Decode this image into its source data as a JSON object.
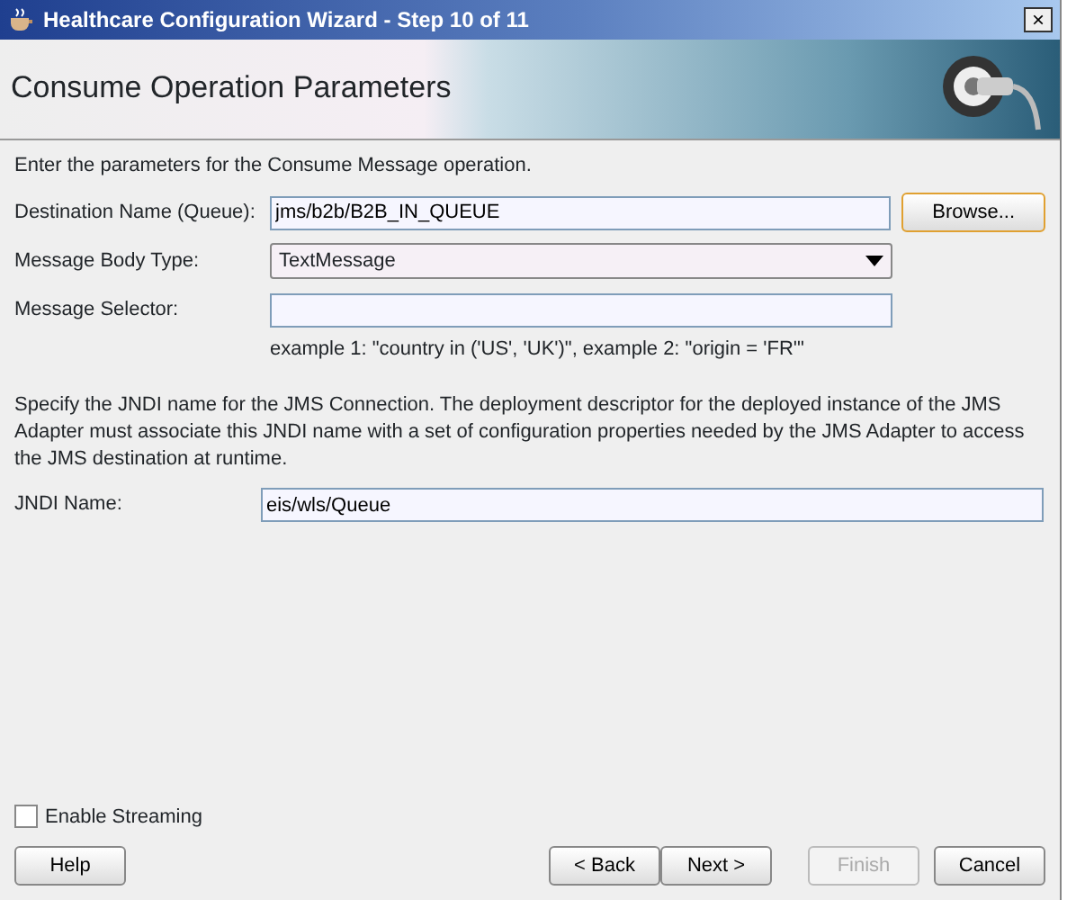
{
  "window": {
    "title": "Healthcare Configuration Wizard - Step 10 of 11",
    "close": "×"
  },
  "header": {
    "title": "Consume Operation Parameters"
  },
  "intro": "Enter the parameters for the Consume Message operation.",
  "fields": [
    {
      "kind": "text",
      "label": "Destination Name (Queue):",
      "value": "jms/b2b/B2B_IN_QUEUE",
      "button": {
        "label": "Browse...",
        "focused": true
      }
    },
    {
      "kind": "select",
      "label": "Message Body Type:",
      "value": "TextMessage"
    },
    {
      "kind": "text",
      "label": "Message Selector:"
    }
  ],
  "example": "example 1: \"country in ('US', 'UK')\", example 2: \"origin = 'FR'\"",
  "jndi_help": "Specify the JNDI name for the JMS Connection.  The deployment descriptor for the deployed instance of the JMS Adapter must associate this JNDI name with a set of configuration properties needed by the JMS Adapter to access the JMS destination at runtime.",
  "jndi": {
    "label": "JNDI Name:",
    "value": "eis/wls/Queue"
  },
  "streaming": {
    "label": "Enable Streaming",
    "checked": false
  },
  "help_button": {
    "label": "Help",
    "disabled": false
  },
  "buttons": [
    {
      "label": "< Back",
      "disabled": false
    },
    {
      "label": "Next >",
      "disabled": false
    },
    {
      "label": "Finish",
      "disabled": true
    },
    {
      "label": "Cancel",
      "disabled": false
    }
  ]
}
